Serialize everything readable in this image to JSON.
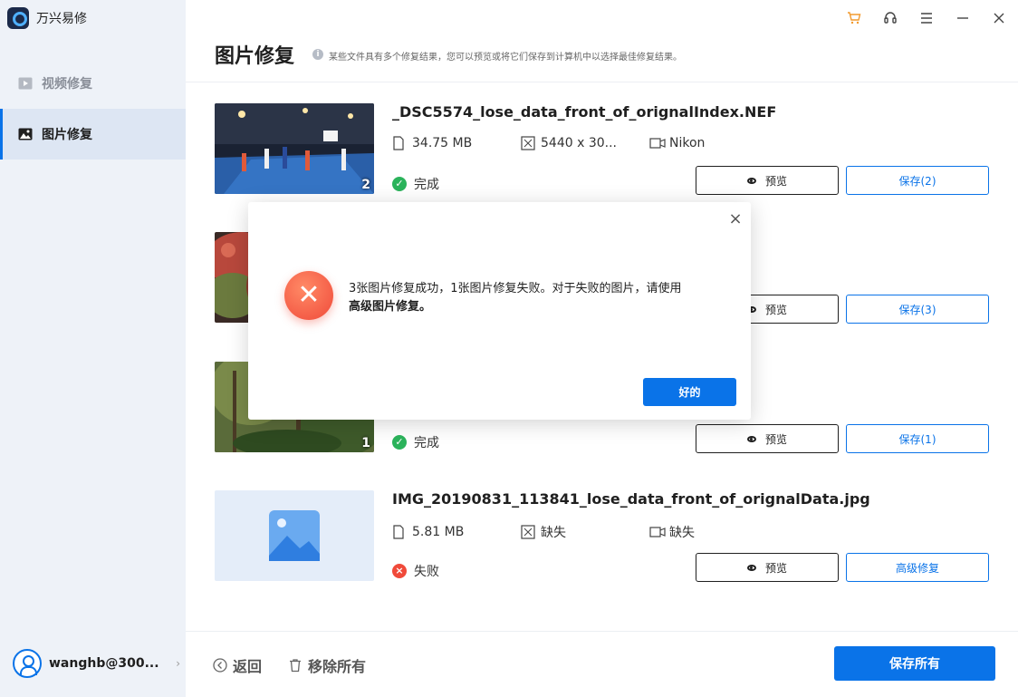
{
  "app": {
    "name": "万兴易修"
  },
  "sidebar": {
    "items": [
      {
        "label": "视频修复",
        "icon": "video-icon",
        "active": false
      },
      {
        "label": "图片修复",
        "icon": "image-icon",
        "active": true
      }
    ],
    "user": {
      "name": "wanghb@300...",
      "icon": "avatar-icon"
    }
  },
  "window_controls": [
    "cart-icon",
    "headset-icon",
    "menu-icon",
    "minimize-icon",
    "close-icon"
  ],
  "header": {
    "title": "图片修复",
    "hint": "某些文件具有多个修复结果，您可以预览或将它们保存到计算机中以选择最佳修复结果。"
  },
  "results": [
    {
      "filename": "_DSC5574_lose_data_front_of_orignalIndex.NEF",
      "size": "34.75  MB",
      "dimensions": "5440 x 30...",
      "device": "Nikon",
      "status": "完成",
      "status_type": "success",
      "count": "2",
      "preview_label": "预览",
      "save_label": "保存(2)"
    },
    {
      "filename": "",
      "size": "",
      "dimensions": "",
      "device": "",
      "status": "",
      "status_type": "success",
      "count": "",
      "preview_label": "预览",
      "save_label": "保存(3)"
    },
    {
      "filename": "",
      "size": "",
      "dimensions": "",
      "device": "",
      "status": "完成",
      "status_type": "success",
      "count": "1",
      "preview_label": "预览",
      "save_label": "保存(1)"
    },
    {
      "filename": "IMG_20190831_113841_lose_data_front_of_orignalData.jpg",
      "size": "5.81  MB",
      "dimensions": "缺失",
      "device": "缺失",
      "status": "失败",
      "status_type": "fail",
      "count": "",
      "preview_label": "预览",
      "save_label": "高级修复"
    }
  ],
  "footer": {
    "back_label": "返回",
    "remove_all_label": "移除所有",
    "save_all_label": "保存所有"
  },
  "dialog": {
    "message": "3张图片修复成功，1张图片修复失败。对于失败的图片，请使用",
    "message_bold": "高级图片修复。",
    "ok_label": "好的"
  },
  "colors": {
    "accent": "#0a73e8",
    "success": "#2bb35b",
    "fail": "#f04a3a",
    "sidebar_bg": "#eef2f8"
  }
}
